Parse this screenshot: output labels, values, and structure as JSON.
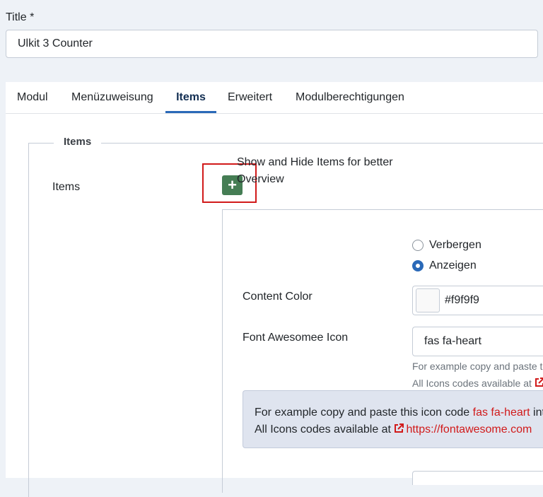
{
  "title_field": {
    "label": "Title *",
    "value": "Ulkit 3 Counter"
  },
  "tabs": [
    {
      "label": "Modul",
      "active": false
    },
    {
      "label": "Menüzuweisung",
      "active": false
    },
    {
      "label": "Items",
      "active": true
    },
    {
      "label": "Erweitert",
      "active": false
    },
    {
      "label": "Modulberechtigungen",
      "active": false
    }
  ],
  "fieldset": {
    "legend": "Items",
    "items_label": "Items",
    "add_button": {
      "symbol": "+",
      "icon": "plus-icon"
    }
  },
  "item": {
    "showhide": {
      "label": "Show and Hide Items for better Overview",
      "options": [
        {
          "label": "Verbergen",
          "checked": false
        },
        {
          "label": "Anzeigen",
          "checked": true
        }
      ]
    },
    "content_color": {
      "label": "Content Color",
      "value": "#f9f9f9"
    },
    "icon_field": {
      "label": "Font Awesomee Icon",
      "value": "fas fa-heart",
      "hint_line1": "For example copy and paste th",
      "hint_line2": "All Icons codes available at"
    },
    "alert": {
      "line1_prefix": "For example copy and paste this icon code ",
      "line1_code": "fas fa-heart",
      "line1_suffix": " int",
      "line2_prefix": "All Icons codes available at ",
      "line2_link": "https://fontawesome.com"
    }
  },
  "colors": {
    "accent": "#2a69b8",
    "add_button": "#457d54",
    "highlight": "#d11a1a",
    "link": "#d11a1a"
  }
}
